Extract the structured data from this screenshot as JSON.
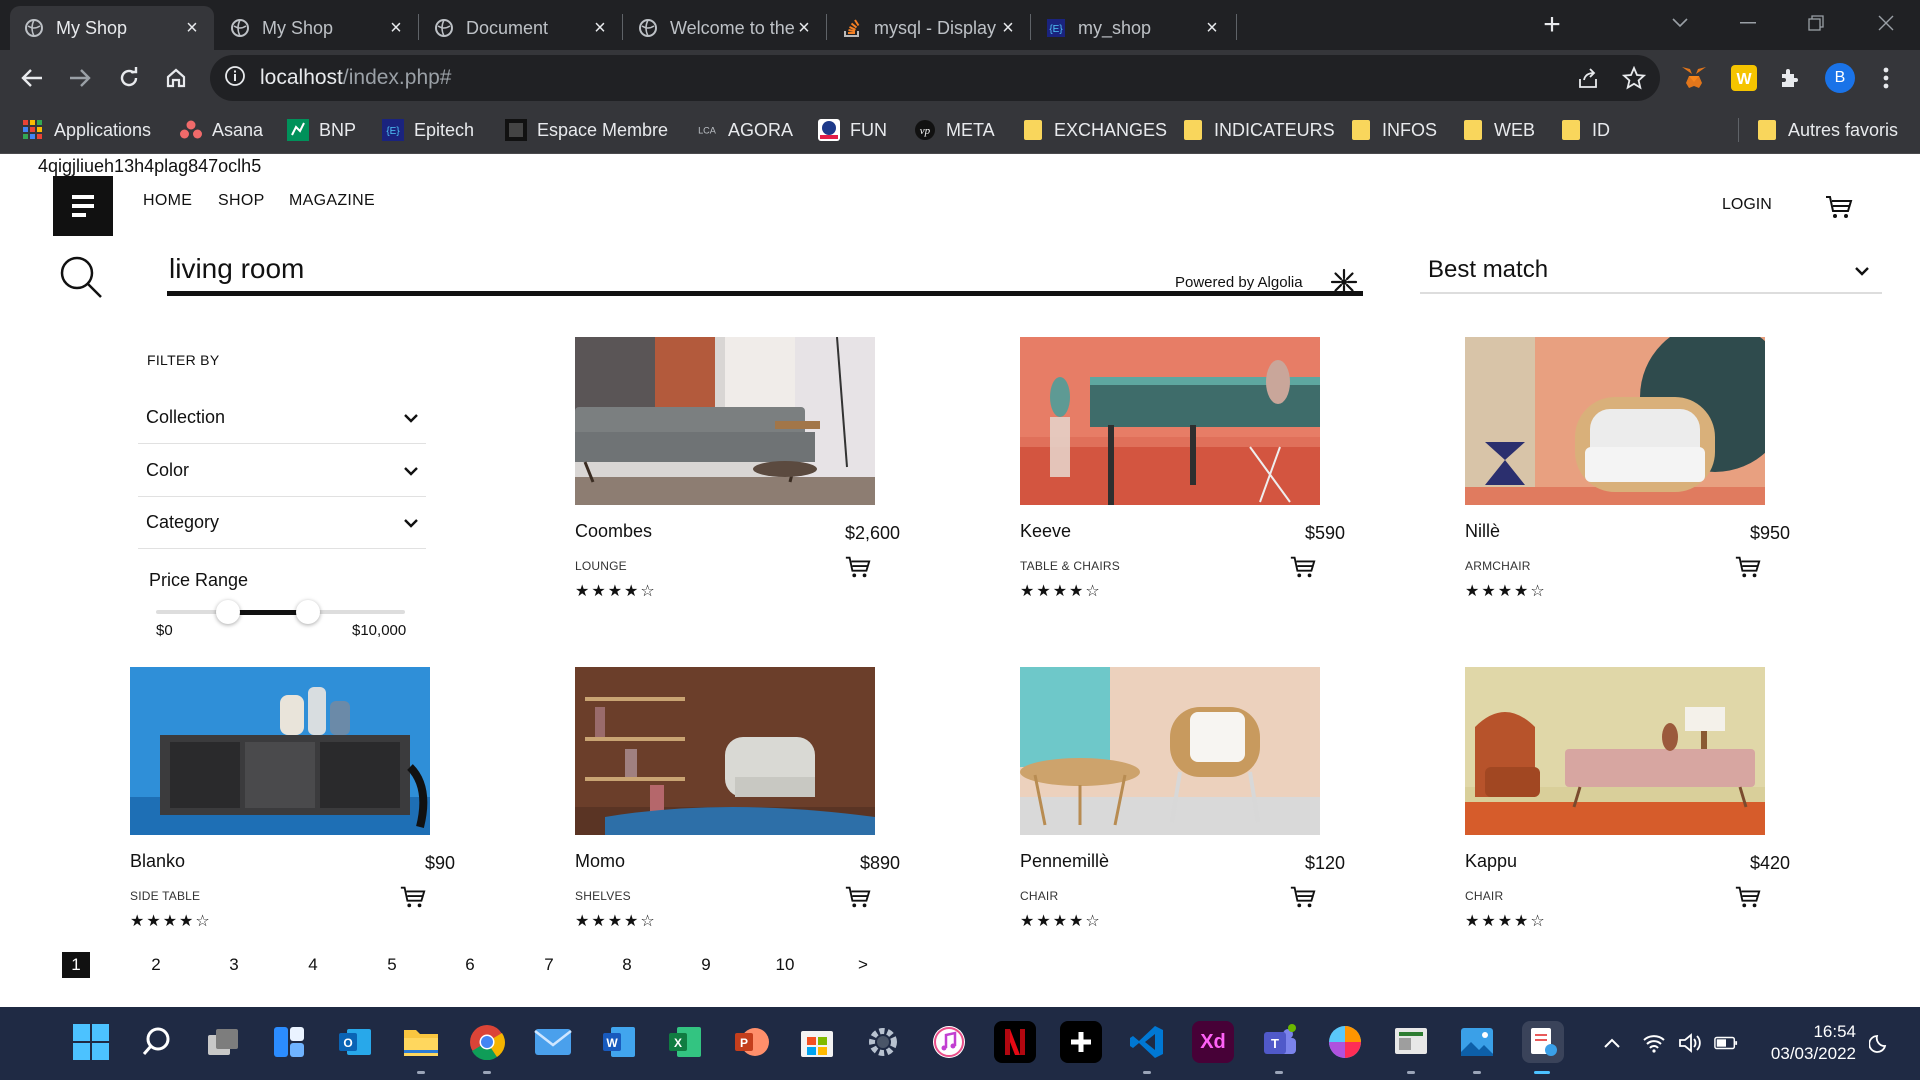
{
  "browser": {
    "tabs": [
      {
        "title": "My Shop",
        "active": true
      },
      {
        "title": "My Shop",
        "active": false
      },
      {
        "title": "Document",
        "active": false
      },
      {
        "title": "Welcome to the ad",
        "active": false
      },
      {
        "title": "mysql - Display pro",
        "active": false
      },
      {
        "title": "my_shop",
        "active": false
      }
    ],
    "url_host": "localhost",
    "url_path": "/index.php#",
    "profile_initial": "B",
    "bookmarks": [
      {
        "label": "Applications",
        "icon": "apps-grid-icon"
      },
      {
        "label": "Asana",
        "icon": "asana-icon"
      },
      {
        "label": "BNP",
        "icon": "bnp-icon"
      },
      {
        "label": "Epitech",
        "icon": "epitech-icon"
      },
      {
        "label": "Espace Membre",
        "icon": "espace-membre-icon"
      },
      {
        "label": "AGORA",
        "icon": "agora-icon"
      },
      {
        "label": "FUN",
        "icon": "fun-icon"
      },
      {
        "label": "META",
        "icon": "meta-icon"
      },
      {
        "label": "EXCHANGES",
        "icon": "folder-icon"
      },
      {
        "label": "INDICATEURS",
        "icon": "folder-icon"
      },
      {
        "label": "INFOS",
        "icon": "folder-icon"
      },
      {
        "label": "WEB",
        "icon": "folder-icon"
      },
      {
        "label": "ID",
        "icon": "folder-icon"
      }
    ],
    "other_bookmarks": "Autres favoris"
  },
  "page": {
    "session_token": "4qigjliueh13h4plag847oclh5",
    "nav": [
      "HOME",
      "SHOP",
      "MAGAZINE"
    ],
    "login_label": "LOGIN",
    "search_value": "living room",
    "powered_by": "Powered by Algolia",
    "sort_selected": "Best match",
    "filter_title": "FILTER BY",
    "filters": [
      "Collection",
      "Color",
      "Category"
    ],
    "price_range": {
      "title": "Price Range",
      "min_label": "$0",
      "max_label": "$10,000",
      "handle_low_fraction": 0.29,
      "handle_high_fraction": 0.61
    },
    "products": [
      {
        "name": "Coombes",
        "price": "$2,600",
        "category": "LOUNGE",
        "rating": 4,
        "stars": "★★★★☆",
        "image": "grey-sofa"
      },
      {
        "name": "Keeve",
        "price": "$590",
        "category": "TABLE & CHAIRS",
        "rating": 4,
        "stars": "★★★★☆",
        "image": "teal-table"
      },
      {
        "name": "Nillè",
        "price": "$950",
        "category": "ARMCHAIR",
        "rating": 4,
        "stars": "★★★★☆",
        "image": "rattan-armchair"
      },
      {
        "name": "Blanko",
        "price": "$90",
        "category": "SIDE TABLE",
        "rating": 4,
        "stars": "★★★★☆",
        "image": "sideboard-blue"
      },
      {
        "name": "Momo",
        "price": "$890",
        "category": "SHELVES",
        "rating": 4,
        "stars": "★★★★☆",
        "image": "shelves-armchair"
      },
      {
        "name": "Pennemillè",
        "price": "$120",
        "category": "CHAIR",
        "rating": 4,
        "stars": "★★★★☆",
        "image": "rattan-chair"
      },
      {
        "name": "Kappu",
        "price": "$420",
        "category": "CHAIR",
        "rating": 4,
        "stars": "★★★★☆",
        "image": "orange-lounge"
      }
    ],
    "pagination": [
      "1",
      "2",
      "3",
      "4",
      "5",
      "6",
      "7",
      "8",
      "9",
      "10",
      ">"
    ],
    "current_page": "1"
  },
  "taskbar": {
    "apps": [
      "windows-start",
      "search",
      "task-view",
      "widgets",
      "outlook",
      "file-explorer",
      "chrome",
      "mail",
      "word",
      "excel",
      "powerpoint",
      "microsoft-store",
      "settings",
      "itunes",
      "netflix",
      "plus-app",
      "vscode",
      "adobe-xd",
      "teams",
      "color-app",
      "screen-app",
      "photos",
      "snipping-tool"
    ],
    "time": "16:54",
    "date": "03/03/2022"
  },
  "colors": {
    "chrome_dark": "#202124",
    "chrome_toolbar": "#35363a",
    "taskbar": "#1f2a44",
    "text": "#111111",
    "folder": "#f9d65c"
  }
}
